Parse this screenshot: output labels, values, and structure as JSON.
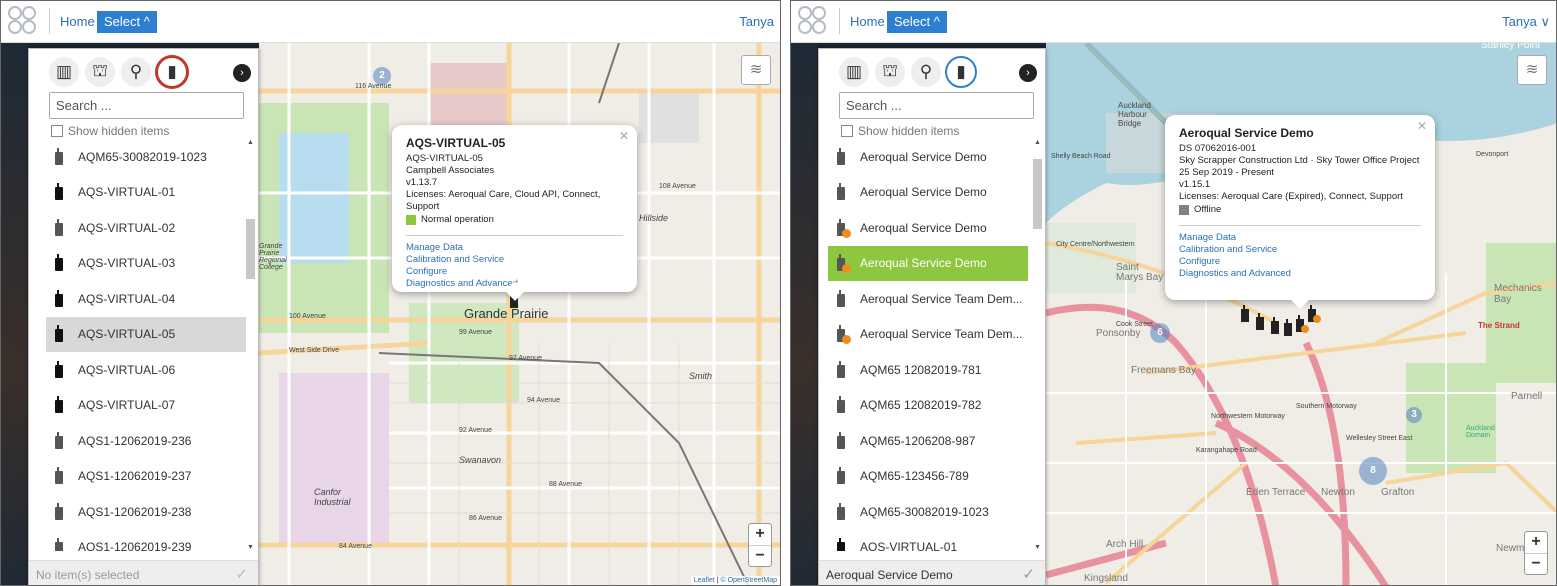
{
  "colors": {
    "accent": "#2f7fd1",
    "selected_green": "#8dc63f",
    "normal_status": "#8dc63f",
    "offline_status": "#808080",
    "highlight_ring": "#c0392b",
    "badge_orange": "#ef8a1f"
  },
  "left": {
    "nav": {
      "home": "Home",
      "select": "Select ^",
      "user": "Tanya"
    },
    "panel": {
      "category_icons": [
        "building-icon",
        "crane-icon",
        "location-pin-icon",
        "monitor-device-icon"
      ],
      "active_category": "monitor-device-icon",
      "search_placeholder": "Search ...",
      "show_hidden": "Show hidden items",
      "items": [
        {
          "label": "AQM65-30082019-1023",
          "state": ""
        },
        {
          "label": "AQS-VIRTUAL-01",
          "state": "dark"
        },
        {
          "label": "AQS-VIRTUAL-02",
          "state": "dark"
        },
        {
          "label": "AQS-VIRTUAL-03",
          "state": "dark"
        },
        {
          "label": "AQS-VIRTUAL-04",
          "state": "dark"
        },
        {
          "label": "AQS-VIRTUAL-05",
          "state": "dark selected"
        },
        {
          "label": "AQS-VIRTUAL-06",
          "state": "dark"
        },
        {
          "label": "AQS-VIRTUAL-07",
          "state": "dark"
        },
        {
          "label": "AQS1-12062019-236",
          "state": ""
        },
        {
          "label": "AQS1-12062019-237",
          "state": ""
        },
        {
          "label": "AQS1-12062019-238",
          "state": ""
        },
        {
          "label": "AQS1-12062019-239",
          "state": ""
        }
      ],
      "status": "No item(s) selected"
    },
    "map": {
      "city_label": "Grande Prairie",
      "street_labels": [
        "116 Avenue",
        "108 Avenue",
        "100 Avenue",
        "99 Avenue",
        "97 Avenue",
        "94 Avenue",
        "92 Avenue",
        "88 Avenue",
        "86 Avenue",
        "84 Avenue",
        "West Side Drive",
        "Canfor Industrial",
        "Swanavon",
        "Smith",
        "Hillside",
        "Grande Prairie Regional College"
      ],
      "cluster": "2",
      "popup": {
        "title": "AQS-VIRTUAL-05",
        "lines": [
          "AQS-VIRTUAL-05",
          "Campbell Associates",
          "v1.13.7",
          "Licenses: Aeroqual Care, Cloud API, Connect, Support"
        ],
        "status": "Normal operation",
        "links": [
          "Manage Data",
          "Calibration and Service",
          "Configure",
          "Diagnostics and Advanced"
        ]
      },
      "attribution_leaflet": "Leaflet",
      "attribution_osm": "© OpenStreetMap"
    }
  },
  "right": {
    "nav": {
      "home": "Home",
      "select": "Select ^",
      "user": "Tanya ∨"
    },
    "panel": {
      "search_placeholder": "Search ...",
      "show_hidden": "Show hidden items",
      "items": [
        {
          "label": "Aeroqual Service Demo",
          "state": ""
        },
        {
          "label": "Aeroqual Service Demo",
          "state": ""
        },
        {
          "label": "Aeroqual Service Demo",
          "state": "badge"
        },
        {
          "label": "Aeroqual Service Demo",
          "state": "badge green"
        },
        {
          "label": "Aeroqual Service Team Dem...",
          "state": ""
        },
        {
          "label": "Aeroqual Service Team Dem...",
          "state": "badge"
        },
        {
          "label": "AQM65 12082019-781",
          "state": ""
        },
        {
          "label": "AQM65 12082019-782",
          "state": ""
        },
        {
          "label": "AQM65-1206208-987",
          "state": ""
        },
        {
          "label": "AQM65-123456-789",
          "state": ""
        },
        {
          "label": "AQM65-30082019-1023",
          "state": ""
        },
        {
          "label": "AQS-VIRTUAL-01",
          "state": "dark"
        }
      ],
      "status": "Aeroqual Service Demo"
    },
    "map": {
      "labels": [
        "Auckland Harbour Bridge",
        "Stanley Point",
        "Saint Marys Bay",
        "Freemans Bay",
        "Ponsonby",
        "Mechanics Bay",
        "Parnell",
        "Newton",
        "Grafton",
        "Eden Terrace",
        "Arch Hill",
        "Kingsland",
        "Newmarket",
        "The Strand",
        "Auckland Domain",
        "Cook Street",
        "Shelly Beach Road",
        "City Centre/Northwestern",
        "Northwestern Motorway",
        "Southern Motorway",
        "Wellesley Street East",
        "Karangahape Road",
        "Devonport"
      ],
      "clusters": [
        "6",
        "3",
        "8"
      ],
      "popup": {
        "title": "Aeroqual Service Demo",
        "lines": [
          "DS 07062016-001",
          "Sky Scrapper Construction Ltd · Sky Tower Office Project",
          "25 Sep 2019 - Present",
          "v1.15.1",
          "Licenses: Aeroqual Care (Expired), Connect, Support"
        ],
        "status": "Offline",
        "links": [
          "Manage Data",
          "Calibration and Service",
          "Configure",
          "Diagnostics and Advanced"
        ]
      }
    }
  }
}
